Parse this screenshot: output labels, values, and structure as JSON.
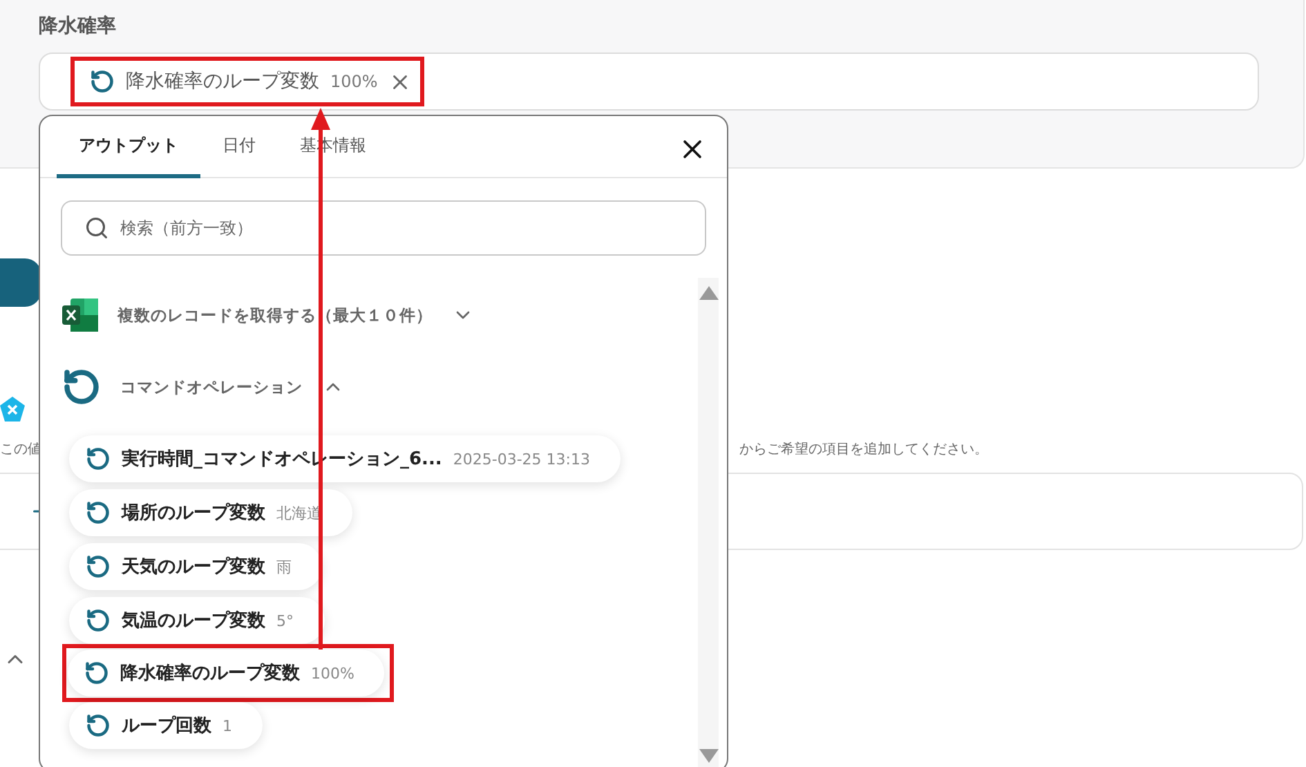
{
  "field": {
    "label": "降水確率",
    "chip": {
      "name": "降水確率のループ変数",
      "value": "100%",
      "highlighted": true
    }
  },
  "background": {
    "left_note": "この値",
    "right_note": "からご希望の項目を追加してください。"
  },
  "popup": {
    "tabs": [
      {
        "label": "アウトプット",
        "selected": true
      },
      {
        "label": "日付",
        "selected": false
      },
      {
        "label": "基本情報",
        "selected": false
      }
    ],
    "search": {
      "placeholder": "検索（前方一致）"
    },
    "sections": [
      {
        "kind": "excel",
        "title": "複数のレコードを取得する（最大１０件）",
        "expanded": false
      },
      {
        "kind": "loop",
        "title": "コマンドオペレーション",
        "expanded": true,
        "items": [
          {
            "name": "実行時間_コマンドオペレーション_6...",
            "value": "2025-03-25 13:13",
            "highlighted": false
          },
          {
            "name": "場所のループ変数",
            "value": "北海道",
            "highlighted": false
          },
          {
            "name": "天気のループ変数",
            "value": "雨",
            "highlighted": false
          },
          {
            "name": "気温のループ変数",
            "value": "5°",
            "highlighted": false
          },
          {
            "name": "降水確率のループ変数",
            "value": "100%",
            "highlighted": true
          },
          {
            "name": "ループ回数",
            "value": "1",
            "highlighted": false
          }
        ]
      }
    ]
  }
}
